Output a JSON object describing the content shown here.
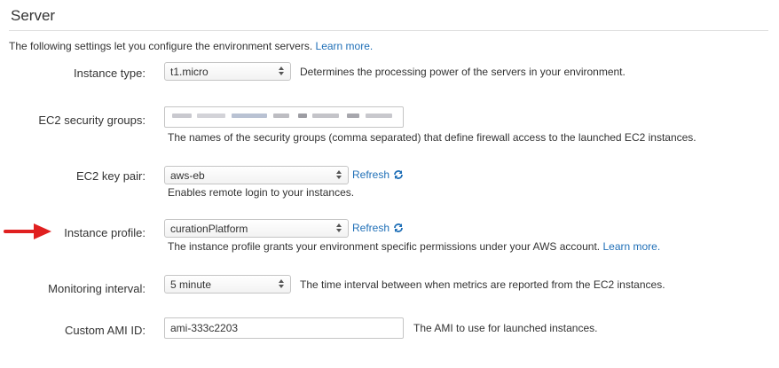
{
  "section": {
    "title": "Server",
    "intro_text": "The following settings let you configure the environment servers.",
    "intro_link": "Learn more."
  },
  "fields": {
    "instance_type": {
      "label": "Instance type:",
      "value": "t1.micro",
      "help": "Determines the processing power of the servers in your environment."
    },
    "security_groups": {
      "label": "EC2 security groups:",
      "help": "The names of the security groups (comma separated) that define firewall access to the launched EC2 instances."
    },
    "key_pair": {
      "label": "EC2 key pair:",
      "value": "aws-eb",
      "refresh_label": "Refresh",
      "help": "Enables remote login to your instances."
    },
    "instance_profile": {
      "label": "Instance profile:",
      "value": "curationPlatform",
      "refresh_label": "Refresh",
      "help": "The instance profile grants your environment specific permissions under your AWS account.",
      "help_link": "Learn more."
    },
    "monitoring_interval": {
      "label": "Monitoring interval:",
      "value": "5 minute",
      "help": "The time interval between when metrics are reported from the EC2 instances."
    },
    "custom_ami": {
      "label": "Custom AMI ID:",
      "value": "ami-333c2203",
      "help": "The AMI to use for launched instances."
    }
  },
  "colors": {
    "link": "#1f6fb7",
    "annotation_arrow": "#e02020"
  },
  "icons": {
    "select_arrows": "up-down-chevron-icon",
    "refresh": "refresh-icon",
    "annotation": "red-arrow-icon"
  }
}
